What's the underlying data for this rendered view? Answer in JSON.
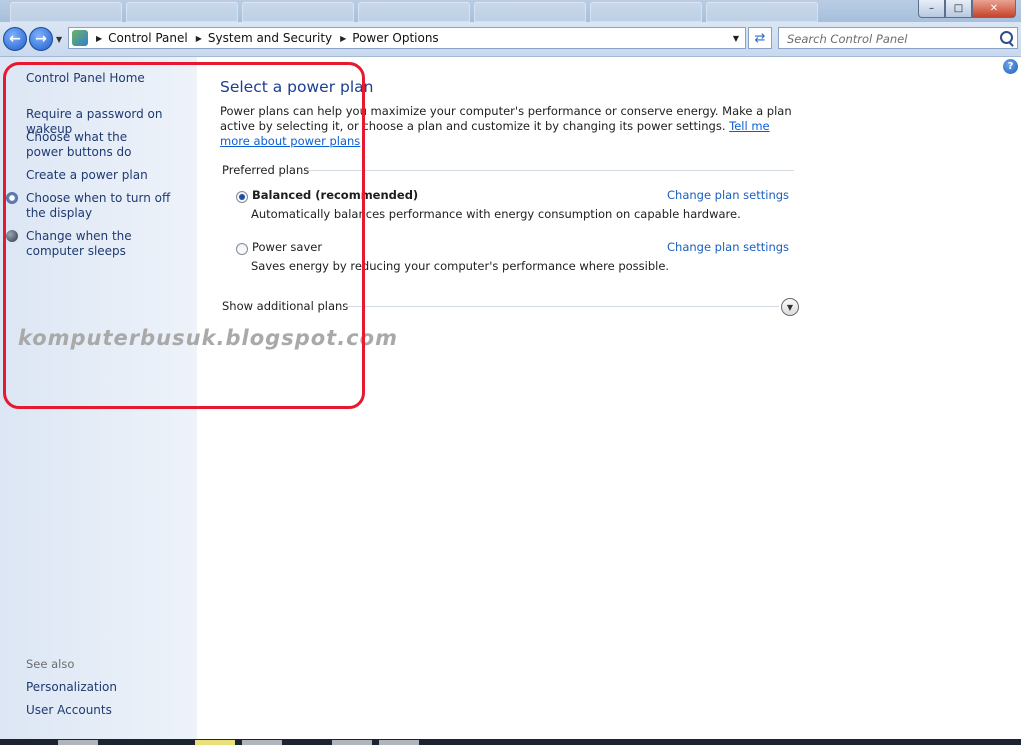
{
  "address_bar": {
    "crumbs": [
      "Control Panel",
      "System and Security",
      "Power Options"
    ]
  },
  "search": {
    "placeholder": "Search Control Panel"
  },
  "sidebar": {
    "home": "Control Panel Home",
    "links": [
      "Require a password on wakeup",
      "Choose what the power buttons do",
      "Create a power plan",
      "Choose when to turn off the display",
      "Change when the computer sleeps"
    ],
    "see_also_label": "See also",
    "see_also": [
      "Personalization",
      "User Accounts"
    ]
  },
  "main": {
    "title": "Select a power plan",
    "description": "Power plans can help you maximize your computer's performance or conserve energy. Make a plan active by selecting it, or choose a plan and customize it by changing its power settings.",
    "tell_me_link": "Tell me more about power plans",
    "preferred_label": "Preferred plans",
    "plans": [
      {
        "name": "Balanced (recommended)",
        "description": "Automatically balances performance with energy consumption on capable hardware.",
        "link": "Change plan settings",
        "selected": true
      },
      {
        "name": "Power saver",
        "description": "Saves energy by reducing your computer's performance where possible.",
        "link": "Change plan settings",
        "selected": false
      }
    ],
    "additional_label": "Show additional plans"
  },
  "watermark": "komputerbusuk.blogspot.com",
  "colors": {
    "highlight": "#e5192f",
    "link": "#1a5fbf",
    "title": "#1b3f8f"
  },
  "icons": [
    "back-icon",
    "forward-icon",
    "control-panel-icon",
    "refresh-icon",
    "search-icon",
    "help-icon",
    "expand-chevron-icon"
  ]
}
